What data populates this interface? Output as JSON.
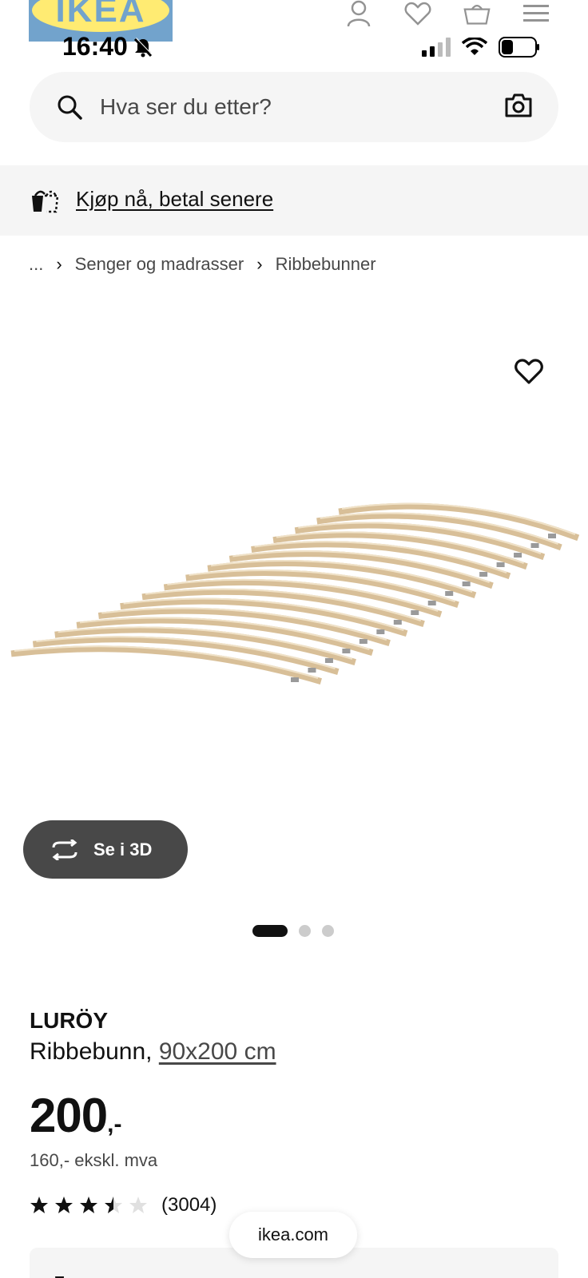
{
  "header": {
    "logo_text": "IKEA",
    "icons": [
      "account-icon",
      "favorites-icon",
      "basket-icon",
      "menu-icon"
    ]
  },
  "status_bar": {
    "time": "16:40"
  },
  "search": {
    "placeholder": "Hva ser du etter?"
  },
  "promo": {
    "link_text": "Kjøp nå, betal senere"
  },
  "breadcrumb": {
    "ellipsis": "...",
    "items": [
      "Senger og madrasser",
      "Ribbebunner"
    ]
  },
  "gallery": {
    "view_3d_label": "Se i 3D",
    "slide_count": 3,
    "active_slide": 1
  },
  "product": {
    "name": "LURÖY",
    "type": "Ribbebunn,",
    "size": "90x200 cm",
    "price_integer": "200",
    "price_suffix": ",-",
    "price_ex_vat": "160,- ekskl. mva",
    "rating_value": 3.5,
    "rating_max": 5,
    "review_count": "(3004)"
  },
  "browser": {
    "domain": "ikea.com"
  },
  "colors": {
    "text": "#111111",
    "secondary_text": "#484848",
    "surface": "#f5f5f5",
    "button_dark": "#484848",
    "logo_blue": "#0058a3",
    "logo_yellow": "#ffdb00"
  }
}
